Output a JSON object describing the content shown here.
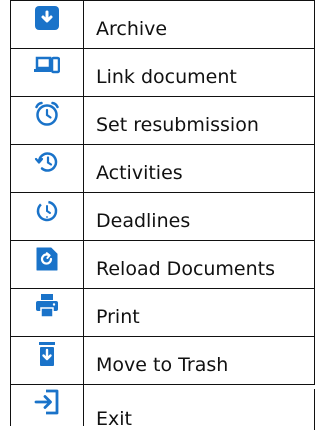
{
  "accent_color": "#1a73c9",
  "menu": {
    "items": [
      {
        "icon": "archive-icon",
        "label": "Archive"
      },
      {
        "icon": "link-document-icon",
        "label": "Link document"
      },
      {
        "icon": "alarm-clock-icon",
        "label": "Set resubmission"
      },
      {
        "icon": "history-icon",
        "label": "Activities"
      },
      {
        "icon": "timer-icon",
        "label": "Deadlines"
      },
      {
        "icon": "reload-documents-icon",
        "label": "Reload Documents"
      },
      {
        "icon": "print-icon",
        "label": "Print"
      },
      {
        "icon": "trash-icon",
        "label": "Move to Trash"
      },
      {
        "icon": "exit-icon",
        "label": "Exit"
      }
    ]
  }
}
